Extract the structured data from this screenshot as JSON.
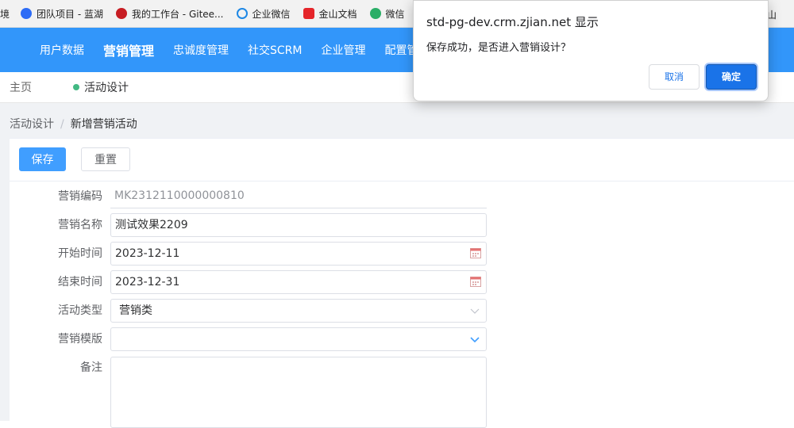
{
  "bookmarks": {
    "items": [
      {
        "label": "境",
        "icon": "none"
      },
      {
        "label": "团队项目 - 蓝湖",
        "icon": "lanhu-icon"
      },
      {
        "label": "我的工作台 - Gitee...",
        "icon": "gitee-icon"
      },
      {
        "label": "企业微信",
        "icon": "wecom-icon"
      },
      {
        "label": "金山文档",
        "icon": "kdocs-icon"
      },
      {
        "label": "微信",
        "icon": "wechat-icon"
      }
    ],
    "right_label": "山"
  },
  "topnav": {
    "items": [
      {
        "label": "用户数据"
      },
      {
        "label": "营销管理"
      },
      {
        "label": "忠诚度管理"
      },
      {
        "label": "社交SCRM"
      },
      {
        "label": "企业管理"
      },
      {
        "label": "配置管"
      }
    ],
    "active_index": 1
  },
  "tabs": {
    "home": "主页",
    "active": "活动设计"
  },
  "breadcrumb": {
    "parent": "活动设计",
    "separator": "/",
    "current": "新增营销活动"
  },
  "toolbar": {
    "save_label": "保存",
    "reset_label": "重置"
  },
  "form": {
    "code": {
      "label": "营销编码",
      "value": "MK2312110000000810"
    },
    "name": {
      "label": "营销名称",
      "value": "测试效果2209"
    },
    "start": {
      "label": "开始时间",
      "value": "2023-12-11"
    },
    "end": {
      "label": "结束时间",
      "value": "2023-12-31"
    },
    "type": {
      "label": "活动类型",
      "value": "营销类"
    },
    "template": {
      "label": "营销模版",
      "value": ""
    },
    "remark": {
      "label": "备注",
      "value": ""
    }
  },
  "dialog": {
    "title": "std-pg-dev.crm.zjian.net 显示",
    "message": "保存成功，是否进入营销设计？",
    "cancel_label": "取消",
    "ok_label": "确定"
  },
  "colors": {
    "nav_blue": "#3296fa",
    "primary": "#409eff",
    "dialog_ok": "#1a73e8",
    "tab_dot": "#42b983"
  }
}
